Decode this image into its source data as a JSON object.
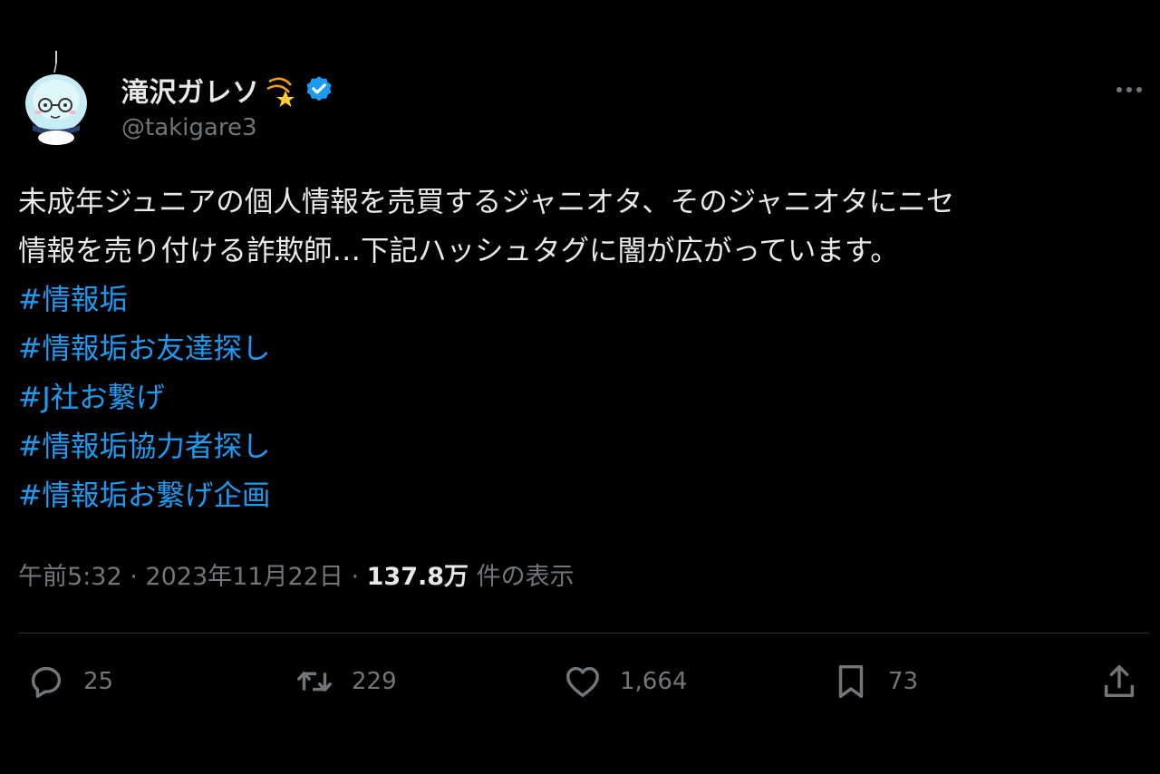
{
  "author": {
    "display_name": "滝沢ガレソ",
    "handle": "@takigare3",
    "name_emoji_icon": "dizzy-icon",
    "verified_icon": "verified-badge-icon"
  },
  "tweet": {
    "text_lines": [
      "未成年ジュニアの個人情報を売買するジャニオタ、そのジャニオタにニセ",
      "情報を売り付ける詐欺師…下記ハッシュタグに闇が広がっています。"
    ],
    "hashtags": [
      "#情報垢",
      "#情報垢お友達探し",
      "#J社お繋げ",
      "#情報垢協力者探し",
      "#情報垢お繋げ企画"
    ]
  },
  "meta": {
    "time": "午前5:32",
    "separator": "·",
    "date": "2023年11月22日",
    "views_count": "137.8万",
    "views_label": "件の表示"
  },
  "actions": {
    "replies": "25",
    "retweets": "229",
    "likes": "1,664",
    "bookmarks": "73"
  },
  "colors": {
    "background": "#000000",
    "text": "#e7e9ea",
    "muted": "#71767b",
    "link": "#1d9bf0",
    "verified": "#1d9bf0",
    "divider": "#2f3336"
  }
}
